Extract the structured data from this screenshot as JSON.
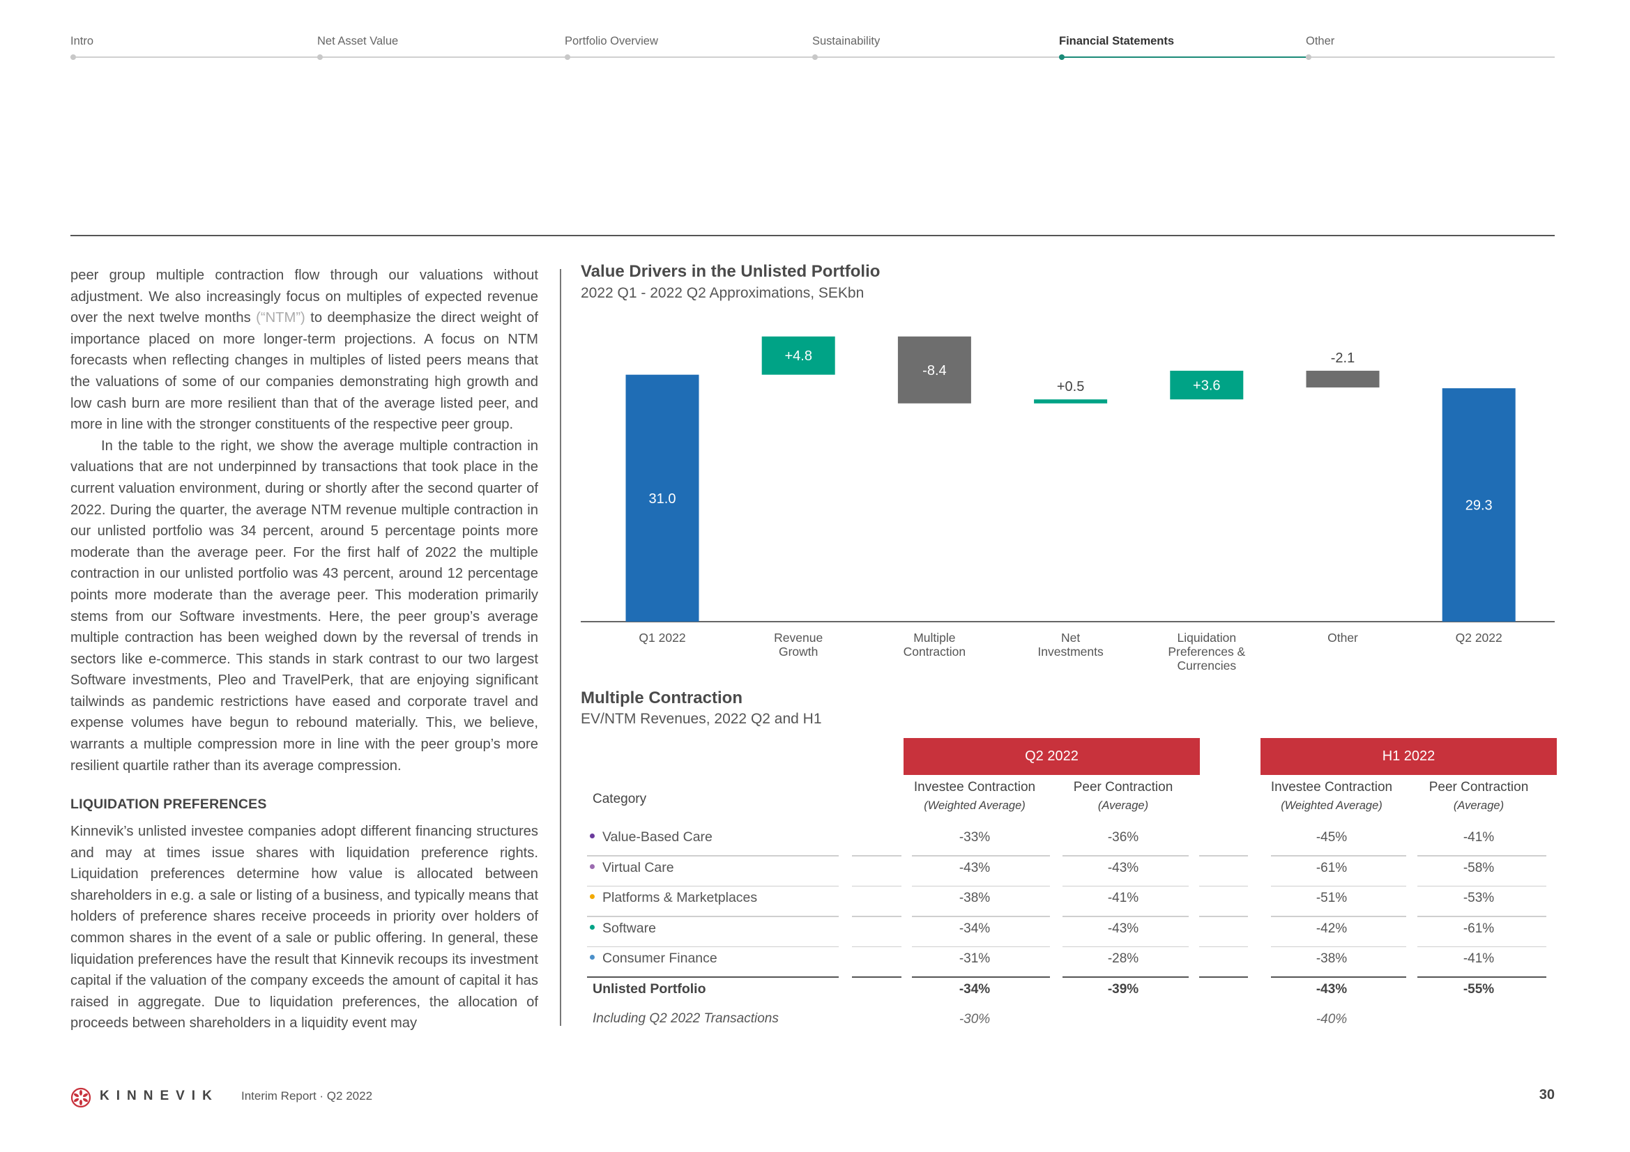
{
  "nav": {
    "items": [
      {
        "label": "Intro",
        "active": false
      },
      {
        "label": "Net Asset Value",
        "active": false
      },
      {
        "label": "Portfolio Overview",
        "active": false
      },
      {
        "label": "Sustainability",
        "active": false
      },
      {
        "label": "Financial Statements",
        "active": true
      },
      {
        "label": "Other",
        "active": false
      }
    ]
  },
  "body": {
    "para1_a": "peer group multiple contraction flow through our valuations without adjustment. We also increasingly focus on multiples of expected revenue over the next twelve months ",
    "para1_ntm": "(“NTM”)",
    "para1_b": " to deemphasize the direct weight of importance placed on more longer-term projections. A focus on NTM forecasts when reflecting changes in multiples of listed peers means that the valuations of some of our companies demonstrating high growth and low cash burn are more resilient than that of the average listed peer, and more in line with the stronger constituents of the respective peer group.",
    "para2": "In the table to the right, we show the average multiple contraction in valuations that are not underpinned by transactions that took place in the current valuation environment, during or shortly after the second quarter of 2022. During the quarter, the average NTM revenue multiple contraction in our unlisted portfolio was 34 percent, around 5 percent­age points more moderate than the average peer. For the first half of 2022 the multiple contraction in our unlisted portfolio was 43 percent, around 12 percentage points more moderate than the average peer. This moderation primarily stems from our Software investments. Here, the peer group’s average multiple contraction has been weighed down by the reversal of trends in sectors like e-commerce. This stands in stark contrast to our two largest Software investments, Pleo and TravelPerk, that are enjoying significant tailwinds as pandemic restrictions have eased and corporate travel and expense volumes have begun to rebound materially. This, we believe, warrants a multiple compression more in line with the peer group’s more resilient quartile rather than its average compression.",
    "section_heading": "LIQUIDATION PREFERENCES",
    "para3": "Kinnevik’s unlisted investee companies adopt different financing struc­tures and may at times issue shares with liquidation preference rights. Liquidation preferences determine how value is allocated between shareholders in e.g. a sale or listing of a business, and typically means that holders of preference shares receive proceeds in priority over holders of common shares in the event of a sale or public offering. In general, these liquidation preferences have the result that Kinnevik recoups its investment capital if the valuation of the company exceeds the amount of capital it has raised in aggregate. Due to liquidation preferences, the allocation of proceeds between shareholders in a liquidity event may"
  },
  "colors": {
    "total": "#1f6db5",
    "increase": "#00a386",
    "decrease": "#6e6e6e",
    "band": "#c8323c",
    "accent": "#1a8a78"
  },
  "chart_data": {
    "type": "bar",
    "subtype": "waterfall",
    "title": "Value Drivers in the Unlisted Portfolio",
    "subtitle": "2022 Q1 - 2022 Q2 Approximations, SEKbn",
    "xlabel": "",
    "ylabel": "",
    "grid": false,
    "categories": [
      "Q1 2022",
      "Revenue Growth",
      "Multiple Contraction",
      "Net Investments",
      "Liquidation Preferences & Currencies",
      "Other",
      "Q2 2022"
    ],
    "category_lines": [
      [
        "Q1 2022"
      ],
      [
        "Revenue",
        "Growth"
      ],
      [
        "Multiple",
        "Contraction"
      ],
      [
        "Net",
        "Investments"
      ],
      [
        "Liquidation",
        "Preferences &",
        "Currencies"
      ],
      [
        "Other"
      ],
      [
        "Q2 2022"
      ]
    ],
    "values": [
      31.0,
      4.8,
      -8.4,
      0.5,
      3.6,
      -2.1,
      29.3
    ],
    "labels": [
      "31.0",
      "+4.8",
      "-8.4",
      "+0.5",
      "+3.6",
      "-2.1",
      "29.3"
    ],
    "kinds": [
      "total",
      "increase",
      "decrease",
      "increase",
      "increase",
      "decrease",
      "total"
    ],
    "ylim": [
      0,
      36
    ]
  },
  "table": {
    "title": "Multiple Contraction",
    "subtitle": "EV/NTM Revenues, 2022 Q2 and H1",
    "category_header": "Category",
    "groups": [
      {
        "label": "Q2 2022",
        "columns": [
          {
            "title": "Investee Contraction",
            "subtitle": "(Weighted Average)"
          },
          {
            "title": "Peer Contraction",
            "subtitle": "(Average)"
          }
        ]
      },
      {
        "label": "H1 2022",
        "columns": [
          {
            "title": "Investee Contraction",
            "subtitle": "(Weighted Average)"
          },
          {
            "title": "Peer Contraction",
            "subtitle": "(Average)"
          }
        ]
      }
    ],
    "rows": [
      {
        "category": "Value-Based Care",
        "dot_color": "#6a3a9c",
        "values": [
          "-33%",
          "-36%",
          "-45%",
          "-41%"
        ]
      },
      {
        "category": "Virtual Care",
        "dot_color": "#9b6bb0",
        "values": [
          "-43%",
          "-43%",
          "-61%",
          "-58%"
        ]
      },
      {
        "category": "Platforms & Marketplaces",
        "dot_color": "#f2a900",
        "values": [
          "-38%",
          "-41%",
          "-51%",
          "-53%"
        ]
      },
      {
        "category": "Software",
        "dot_color": "#00a386",
        "values": [
          "-34%",
          "-43%",
          "-42%",
          "-61%"
        ]
      },
      {
        "category": "Consumer Finance",
        "dot_color": "#4b8fc9",
        "values": [
          "-31%",
          "-28%",
          "-38%",
          "-41%"
        ]
      }
    ],
    "total": {
      "category": "Unlisted Portfolio",
      "values": [
        "-34%",
        "-39%",
        "-43%",
        "-55%"
      ]
    },
    "including": {
      "category": "Including Q2 2022 Transactions",
      "values": [
        "-30%",
        "",
        "-40%",
        ""
      ]
    }
  },
  "footer": {
    "brand": "KINNEVIK",
    "report": "Interim Report · Q2 2022",
    "page": "30"
  }
}
